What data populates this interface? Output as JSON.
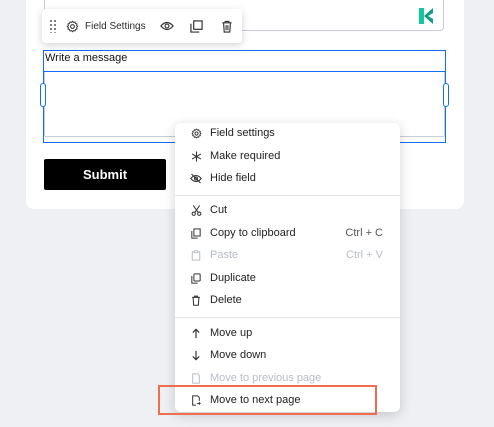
{
  "toolbar": {
    "field_settings_label": "Field Settings",
    "icons": [
      "drag-handle-icon",
      "gear-icon",
      "eye-icon",
      "duplicate-icon",
      "trash-icon"
    ]
  },
  "form": {
    "message_label": "Write a message",
    "submit_label": "Submit",
    "brand_icon": "k-logo-icon",
    "brand_color": "#16c4a4"
  },
  "context_menu": {
    "items": [
      {
        "label": "Field settings",
        "icon": "gear-icon",
        "disabled": false
      },
      {
        "label": "Make required",
        "icon": "asterisk-icon",
        "disabled": false
      },
      {
        "label": "Hide field",
        "icon": "eye-off-icon",
        "disabled": false
      },
      {
        "label": "Cut",
        "icon": "scissors-icon",
        "disabled": false
      },
      {
        "label": "Copy to clipboard",
        "shortcut": "Ctrl + C",
        "icon": "copy-icon",
        "disabled": false
      },
      {
        "label": "Paste",
        "shortcut": "Ctrl + V",
        "icon": "paste-icon",
        "disabled": true
      },
      {
        "label": "Duplicate",
        "icon": "duplicate-icon",
        "disabled": false
      },
      {
        "label": "Delete",
        "icon": "trash-icon",
        "disabled": false
      },
      {
        "label": "Move up",
        "icon": "arrow-up-icon",
        "disabled": false
      },
      {
        "label": "Move down",
        "icon": "arrow-down-icon",
        "disabled": false
      },
      {
        "label": "Move to previous page",
        "icon": "page-prev-icon",
        "disabled": true
      },
      {
        "label": "Move to next page",
        "icon": "page-next-icon",
        "disabled": false
      }
    ]
  },
  "colors": {
    "selection": "#116dff",
    "highlight": "#ef6e52"
  }
}
